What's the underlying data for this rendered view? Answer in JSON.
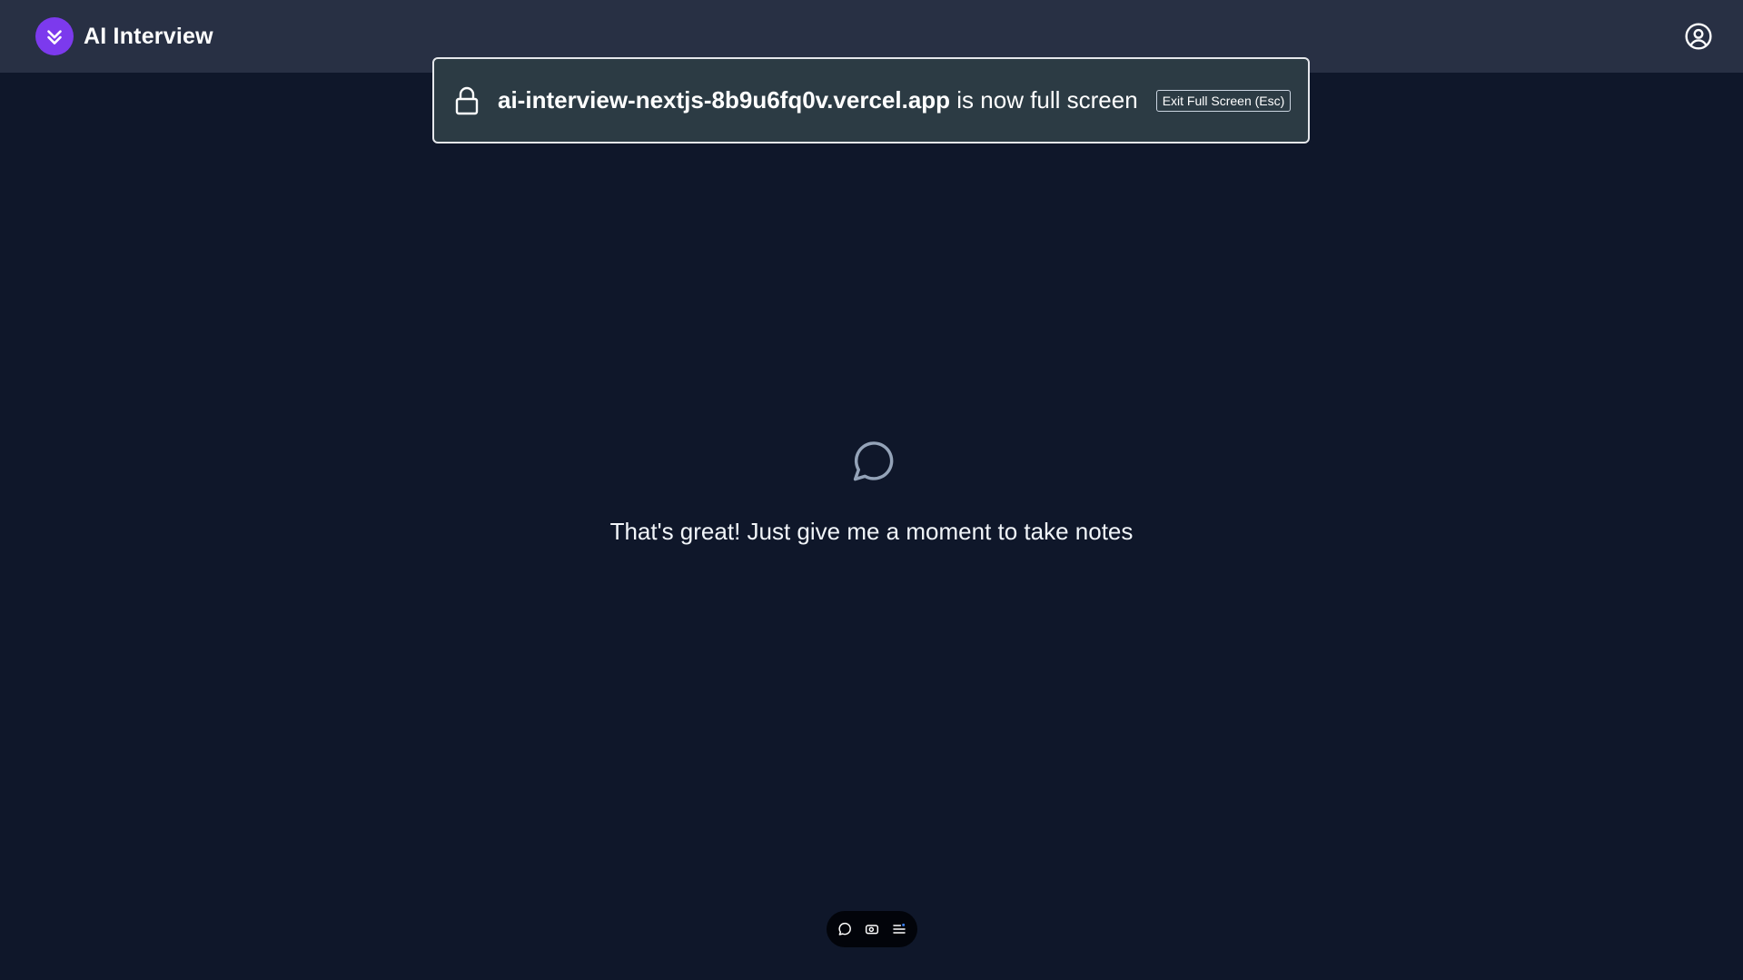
{
  "header": {
    "title": "AI Interview",
    "logo_icon": "chevrons-down-icon",
    "profile_icon": "user-circle-icon",
    "brand_color": "#7c3aed",
    "background": "#283044"
  },
  "fullscreen_notice": {
    "host": "ai-interview-nextjs-8b9u6fq0v.vercel.app",
    "suffix": " is now full screen",
    "exit_label": "Exit Full Screen (Esc)",
    "lock_icon": "lock-icon"
  },
  "main": {
    "icon": "message-circle-icon",
    "message": "That's great! Just give me a moment to take notes",
    "background": "#0f172a"
  },
  "toolbar": {
    "buttons": [
      {
        "icon": "chat-bubble-icon"
      },
      {
        "icon": "camera-icon"
      },
      {
        "icon": "list-settings-icon"
      }
    ]
  }
}
